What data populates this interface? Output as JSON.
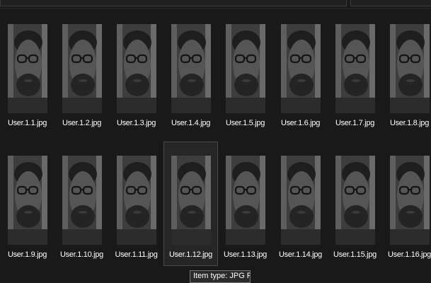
{
  "files": [
    {
      "name": "User.1.1.jpg"
    },
    {
      "name": "User.1.2.jpg"
    },
    {
      "name": "User.1.3.jpg"
    },
    {
      "name": "User.1.4.jpg"
    },
    {
      "name": "User.1.5.jpg"
    },
    {
      "name": "User.1.6.jpg"
    },
    {
      "name": "User.1.7.jpg"
    },
    {
      "name": "User.1.8.jpg"
    },
    {
      "name": "User.1.9.jpg"
    },
    {
      "name": "User.1.10.jpg"
    },
    {
      "name": "User.1.11.jpg"
    },
    {
      "name": "User.1.12.jpg"
    },
    {
      "name": "User.1.13.jpg"
    },
    {
      "name": "User.1.14.jpg"
    },
    {
      "name": "User.1.15.jpg"
    },
    {
      "name": "User.1.16.jpg"
    }
  ],
  "tooltip": {
    "text": "Item type: JPG File"
  },
  "colors": {
    "background": "#191919",
    "label": "#ffffff",
    "tooltip_bg": "#2b2b2b",
    "tooltip_border": "#767676"
  }
}
